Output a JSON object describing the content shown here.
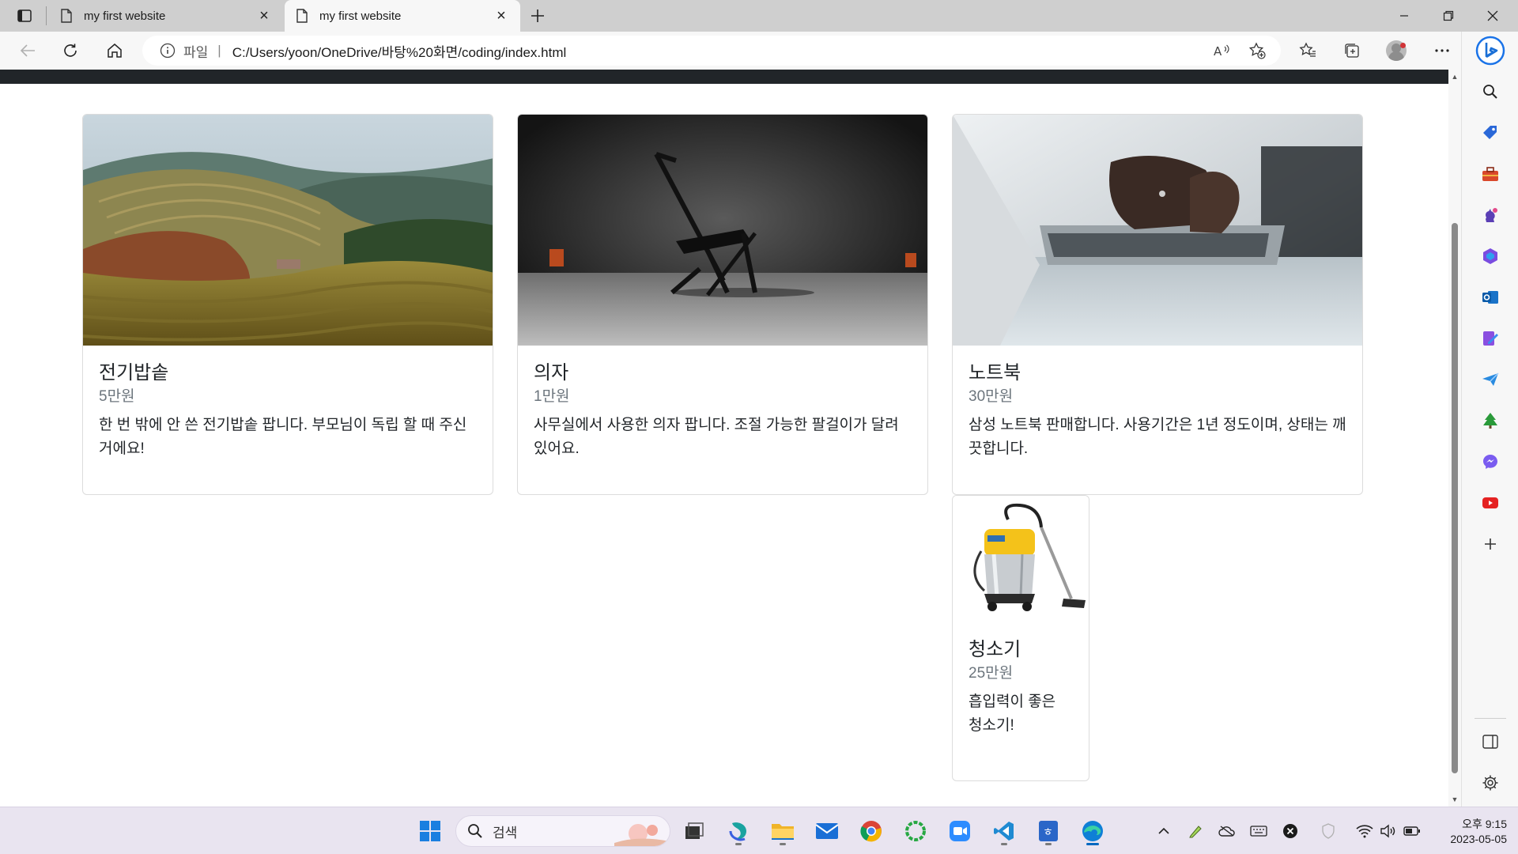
{
  "browser": {
    "tabs": [
      {
        "title": "my first website",
        "active": false
      },
      {
        "title": "my first website",
        "active": true
      }
    ],
    "address": {
      "scheme_label": "파일",
      "url": "C:/Users/yoon/OneDrive/바탕%20화면/coding/index.html"
    }
  },
  "page": {
    "cards": [
      {
        "title": "전기밥솥",
        "price": "5만원",
        "description": "한 번 밖에 안 쓴 전기밥솥 팝니다. 부모님이 독립 할 때 주신 거에요!",
        "image": "rice-terraces-photo"
      },
      {
        "title": "의자",
        "price": "1만원",
        "description": "사무실에서 사용한 의자 팝니다. 조절 가능한 팔걸이가 달려있어요.",
        "image": "folding-chair-photo"
      },
      {
        "title": "노트북",
        "price": "30만원",
        "description": "삼성 노트북 판매합니다. 사용기간은 1년 정도이며, 상태는 깨끗합니다.",
        "image": "laptop-typing-photo"
      },
      {
        "title": "청소기",
        "price": "25만원",
        "description": "흡입력이 좋은 청소기!",
        "image": "vacuum-cleaner-photo"
      }
    ]
  },
  "taskbar": {
    "search_label": "검색",
    "clock": {
      "time": "오후 9:15",
      "date": "2023-05-05"
    }
  },
  "colors": {
    "navbar": "#212529",
    "text": "#212529",
    "muted": "#6c757d",
    "edge_accent": "#0067c0"
  }
}
